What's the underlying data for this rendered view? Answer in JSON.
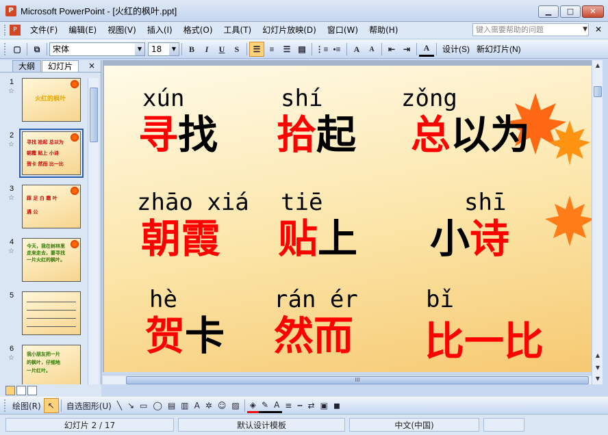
{
  "window": {
    "title": "Microsoft PowerPoint - [火红的枫叶.ppt]",
    "app_icon": "powerpoint-icon",
    "buttons": [
      "minimize",
      "maximize",
      "close"
    ]
  },
  "menubar": {
    "items": [
      "文件(F)",
      "编辑(E)",
      "视图(V)",
      "插入(I)",
      "格式(O)",
      "工具(T)",
      "幻灯片放映(D)",
      "窗口(W)",
      "帮助(H)"
    ],
    "help_placeholder": "键入需要帮助的问题"
  },
  "toolbar": {
    "font": "宋体",
    "size": "18",
    "bold": "B",
    "italic": "I",
    "underline": "U",
    "shadow": "S",
    "font_grow": "A",
    "font_shrink": "A",
    "font_color": "A",
    "design_label": "设计(S)",
    "new_slide_label": "新幻灯片(N)"
  },
  "left_pane": {
    "tabs": [
      "大纲",
      "幻灯片"
    ],
    "active_tab": "幻灯片",
    "close": "×",
    "slides": [
      {
        "num": "1",
        "selected": false
      },
      {
        "num": "2",
        "selected": true
      },
      {
        "num": "3",
        "selected": false
      },
      {
        "num": "4",
        "selected": false
      },
      {
        "num": "5",
        "selected": false
      },
      {
        "num": "6",
        "selected": false
      }
    ]
  },
  "slide": {
    "rows": [
      [
        {
          "pinyin": "xún",
          "red": "寻",
          "black": "找",
          "order": "red-first"
        },
        {
          "pinyin": "shí",
          "red": "拾",
          "black": "起",
          "order": "red-first"
        },
        {
          "pinyin": "zǒng",
          "red": "总",
          "black": "以为",
          "order": "red-first"
        }
      ],
      [
        {
          "pinyin": "zhāo xiá",
          "red": "朝霞",
          "black": "",
          "order": "red-first"
        },
        {
          "pinyin": "tiē",
          "red": "贴",
          "black": "上",
          "order": "red-first"
        },
        {
          "pinyin": "shī",
          "red": "诗",
          "black": "小",
          "order": "black-first"
        }
      ],
      [
        {
          "pinyin": "hè",
          "red": "贺",
          "black": "卡",
          "order": "red-first"
        },
        {
          "pinyin": "rán ér",
          "red": "然而",
          "black": "",
          "order": "red-first"
        },
        {
          "pinyin": "bǐ",
          "red": "比一比",
          "black": "",
          "order": "red-first"
        }
      ]
    ],
    "colors": {
      "red": "#ff0000",
      "black": "#000000"
    }
  },
  "drawbar": {
    "draw_label": "绘图(R)",
    "autoshapes_label": "自选图形(U)"
  },
  "statusbar": {
    "slide_info": "幻灯片 2 / 17",
    "template": "默认设计模板",
    "language": "中文(中国)"
  }
}
